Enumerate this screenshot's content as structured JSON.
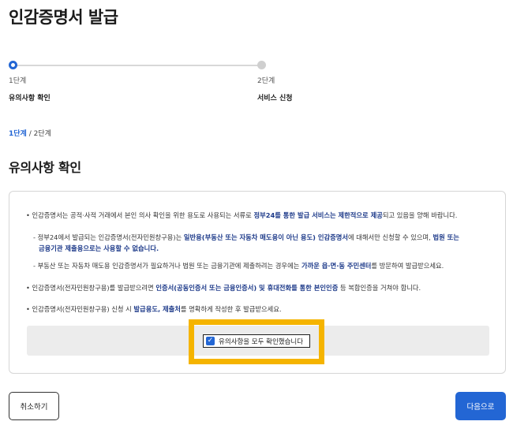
{
  "page": {
    "title": "인감증명서 발급"
  },
  "stepper": {
    "steps": [
      {
        "num": "1단계",
        "name": "유의사항 확인",
        "state": "active"
      },
      {
        "num": "2단계",
        "name": "서비스 신청",
        "state": "inactive"
      }
    ]
  },
  "breadcrumb": {
    "current": "1단계",
    "sep": " / ",
    "next": "2단계"
  },
  "section": {
    "title": "유의사항 확인"
  },
  "notices": {
    "n1": {
      "pre": "• 인감증명서는 공적·사적 거래에서 본인 의사 확인을 위한 용도로 사용되는 서류로 ",
      "bold": "정부24를 통한 발급 서비스는 제한적으로 제공",
      "post": "되고 있음을 양해 바랍니다."
    },
    "n1a": {
      "line1_pre": "- 정부24에서 발급되는 인감증명서(전자민원창구용)는 ",
      "line1_bold1": "일반용(부동산 또는 자동차 매도용이 아닌 용도) 인감증명서",
      "line1_mid": "에 대해서만 신청할 수 있으며, ",
      "line1_bold2": "법원 또는",
      "line2_bold": "금융기관 제출용으로는 사용할 수 없습니다."
    },
    "n1b": {
      "pre": "- 부동산 또는 자동차 매도용 인감증명서가 필요하거나 법원 또는 금융기관에 제출하려는 경우에는 ",
      "bold": "가까운 읍·면·동 주민센터",
      "post": "를 방문하여 발급받으세요."
    },
    "n2": {
      "pre": "• 인감증명서(전자민원창구용)를 발급받으려면 ",
      "bold": "인증서(공동인증서 또는 금융인증서) 및 휴대전화를 통한 본인인증",
      "post": " 등 복합인증을 거쳐야 합니다."
    },
    "n3": {
      "pre": "• 인감증명서(전자민원창구용) 신청 시 ",
      "bold": "발급용도, 제출처",
      "post": "를 명확하게 작성한 후 발급받으세요."
    }
  },
  "agree": {
    "label": "유의사항을 모두 확인했습니다",
    "checked": true
  },
  "buttons": {
    "cancel": "취소하기",
    "next": "다음으로"
  },
  "colors": {
    "accent": "#2366d4",
    "highlight": "#f5b400",
    "emphasis": "#1e3b8a"
  }
}
